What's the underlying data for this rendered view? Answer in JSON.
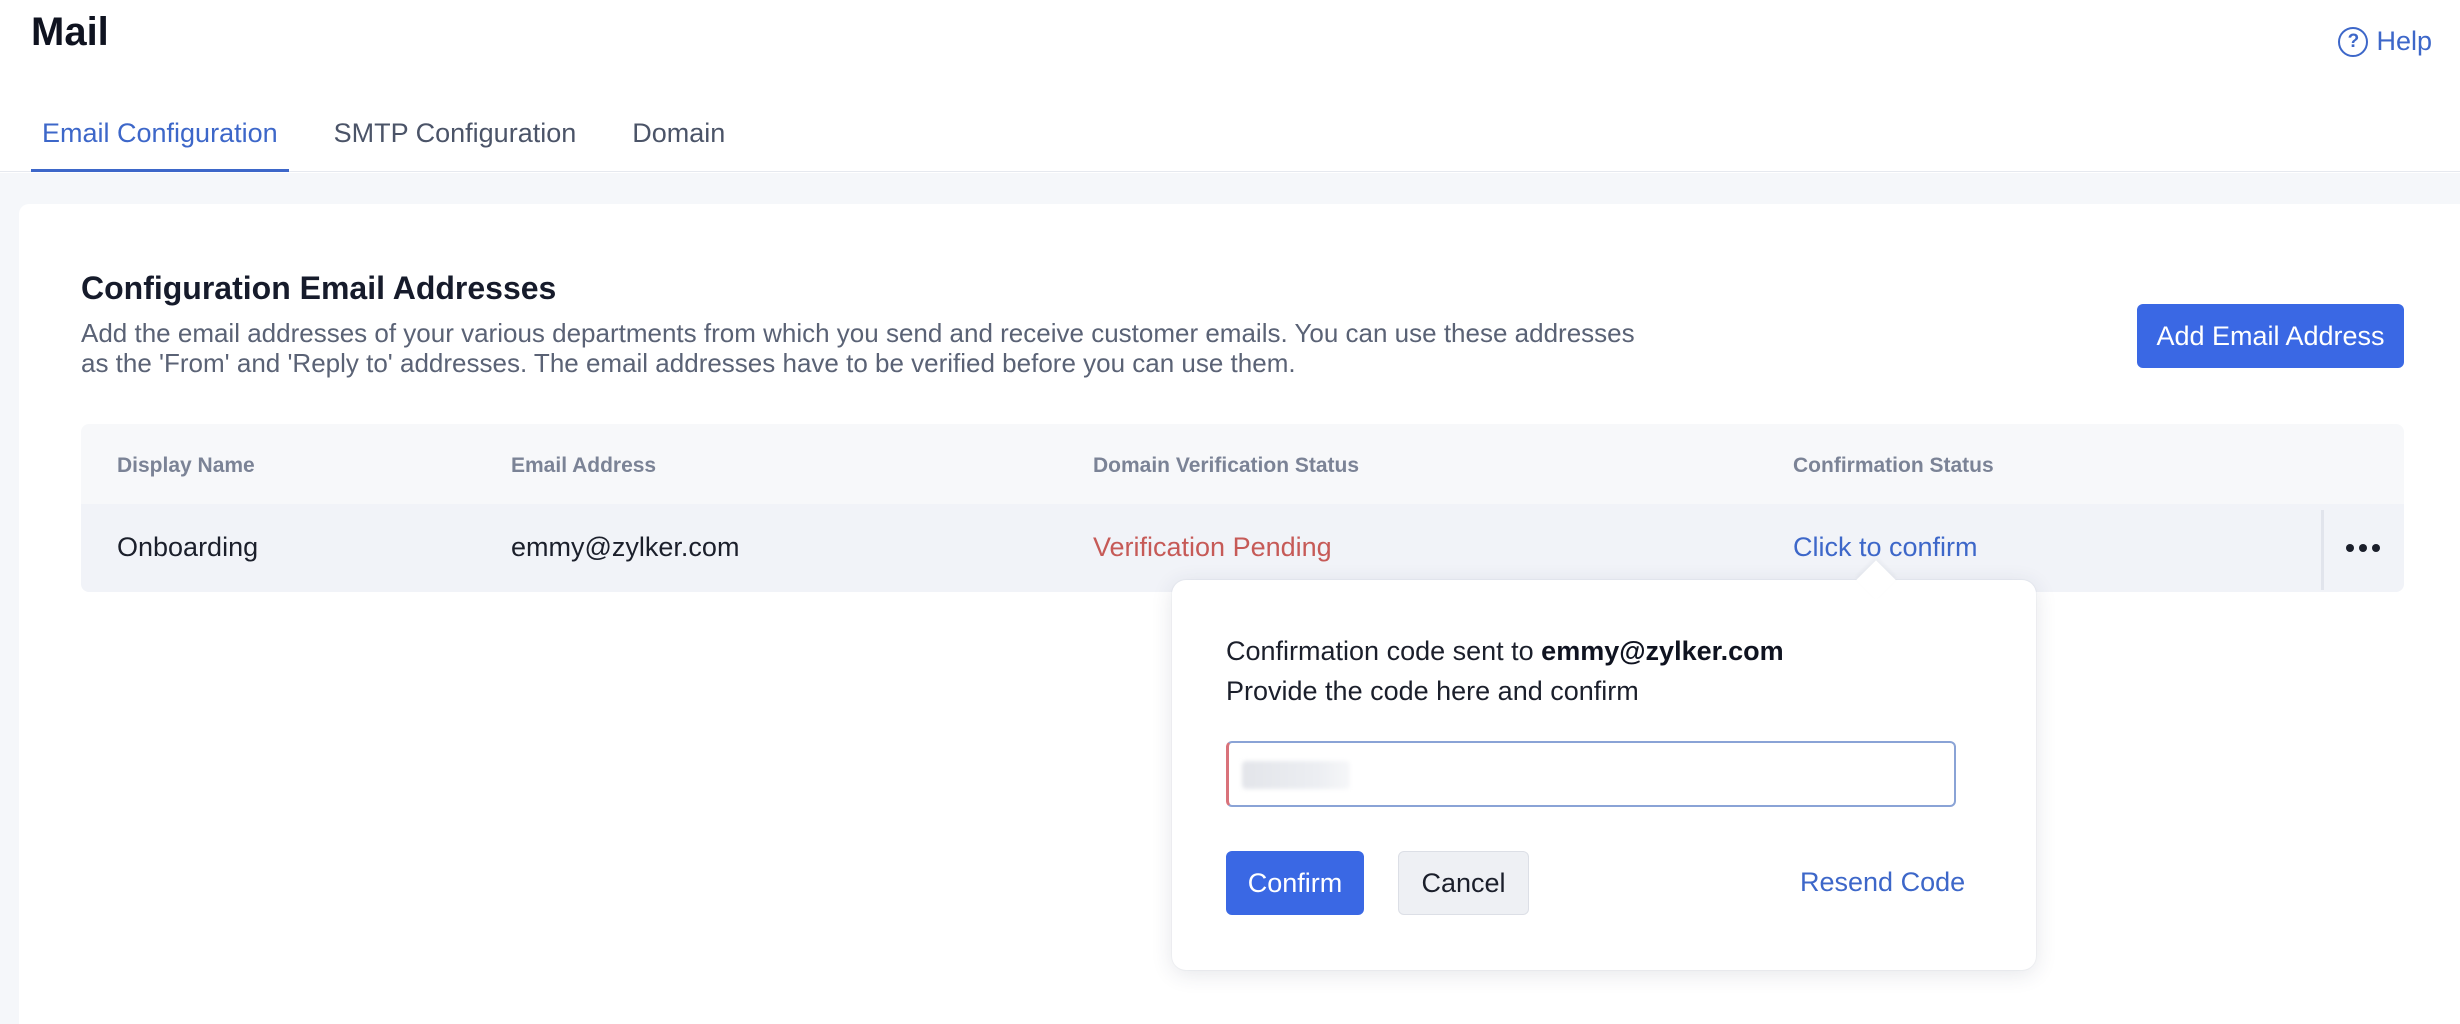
{
  "header": {
    "title": "Mail",
    "help_label": "Help",
    "help_icon": "?"
  },
  "tabs": [
    {
      "label": "Email Configuration",
      "active": true
    },
    {
      "label": "SMTP Configuration",
      "active": false
    },
    {
      "label": "Domain",
      "active": false
    }
  ],
  "section": {
    "title": "Configuration Email Addresses",
    "description": "Add the email addresses of your various departments from which you send and receive customer emails. You can use these addresses as the 'From' and 'Reply to' addresses. The email addresses have to be verified before you can use them.",
    "add_button_label": "Add Email Address"
  },
  "table": {
    "columns": [
      "Display Name",
      "Email Address",
      "Domain Verification Status",
      "Confirmation Status"
    ],
    "rows": [
      {
        "display_name": "Onboarding",
        "email": "emmy@zylker.com",
        "domain_status": "Verification Pending",
        "confirmation_status": "Click to confirm"
      }
    ]
  },
  "popover": {
    "line1_prefix": "Confirmation code sent to ",
    "line1_email": "emmy@zylker.com",
    "line2": "Provide the code here and confirm",
    "input_value": "",
    "confirm_label": "Confirm",
    "cancel_label": "Cancel",
    "resend_label": "Resend Code"
  },
  "colors": {
    "accent": "#3a68e4",
    "link": "#3d67c9",
    "pending": "#c65a57"
  }
}
